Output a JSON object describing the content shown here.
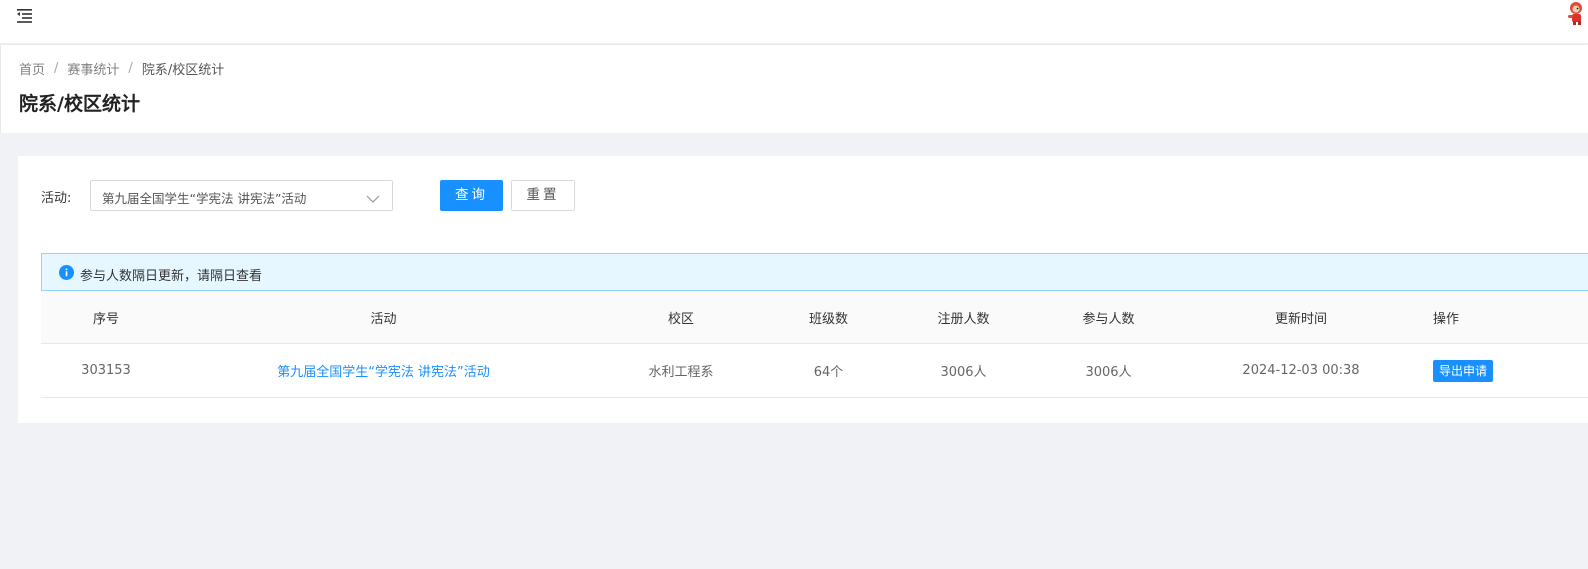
{
  "topbar": {
    "menu_icon": "menu-fold-icon",
    "avatar_icon": "mascot-avatar-icon"
  },
  "breadcrumb": {
    "items": [
      "首页",
      "赛事统计",
      "院系/校区统计"
    ],
    "separator": "/"
  },
  "page": {
    "title": "院系/校区统计"
  },
  "filter": {
    "label": "活动:",
    "activity_value": "第九届全国学生“学宪法 讲宪法”活动",
    "query_label": "查询",
    "reset_label": "重置"
  },
  "notice": {
    "icon": "info-icon",
    "text": "参与人数隔日更新，请隔日查看"
  },
  "table": {
    "columns": [
      "序号",
      "活动",
      "校区",
      "班级数",
      "注册人数",
      "参与人数",
      "更新时间",
      "操作"
    ],
    "rows": [
      {
        "seq": "303153",
        "activity": "第九届全国学生“学宪法 讲宪法”活动",
        "campus": "水利工程系",
        "classes": "64个",
        "registered": "3006人",
        "participants": "3006人",
        "updated": "2024-12-03 00:38",
        "action": "导出申请"
      }
    ]
  },
  "colors": {
    "primary": "#1890ff",
    "notice_bg": "#e6f7ff",
    "notice_border": "#91d5ff",
    "page_bg": "#f0f2f5"
  }
}
